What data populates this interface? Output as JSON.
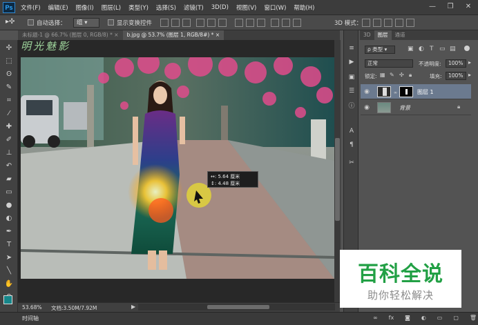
{
  "app": {
    "logo": "Ps",
    "menu": [
      "文件(F)",
      "编辑(E)",
      "图像(I)",
      "图层(L)",
      "类型(Y)",
      "选择(S)",
      "滤镜(T)",
      "3D(D)",
      "视图(V)",
      "窗口(W)",
      "帮助(H)"
    ],
    "window_controls": [
      "minimize",
      "restore",
      "close"
    ]
  },
  "options": {
    "auto_select_label": "自动选择：",
    "auto_select_value": "组",
    "transform_label": "显示变换控件",
    "mode_3d_label": "3D 模式："
  },
  "tabs": [
    {
      "label": "未标题-1 @ 66.7% (图层 0, RGB/8) *",
      "active": false
    },
    {
      "label": "b.jpg @ 53.7% (图层 1, RGB/8#) *",
      "active": true
    }
  ],
  "canvas": {
    "signature": "明光魅影",
    "measure_w": "5.64 厘米",
    "measure_h": "4.48 厘米"
  },
  "status": {
    "zoom": "53.68%",
    "doc": "文档:3.50M/7.92M",
    "timeline": "时间轴"
  },
  "layers_panel": {
    "tabs": [
      "3D",
      "图层",
      "通道"
    ],
    "active_tab": "图层",
    "filter_kind": "ρ 类型",
    "blend_mode": "正常",
    "opacity_label": "不透明度:",
    "opacity_value": "100%",
    "lock_label": "锁定:",
    "fill_label": "填充:",
    "fill_value": "100%",
    "layers": [
      {
        "name": "图层 1",
        "selected": true,
        "italic": false
      },
      {
        "name": "背景",
        "selected": false,
        "italic": true
      }
    ]
  },
  "watermark": {
    "title": "百科全说",
    "subtitle": "助你轻松解决"
  },
  "colors": {
    "menubar": "#3c3c3c",
    "workspace": "#535353",
    "accent_green": "#22a045",
    "selected_layer": "#6b7a8f"
  }
}
